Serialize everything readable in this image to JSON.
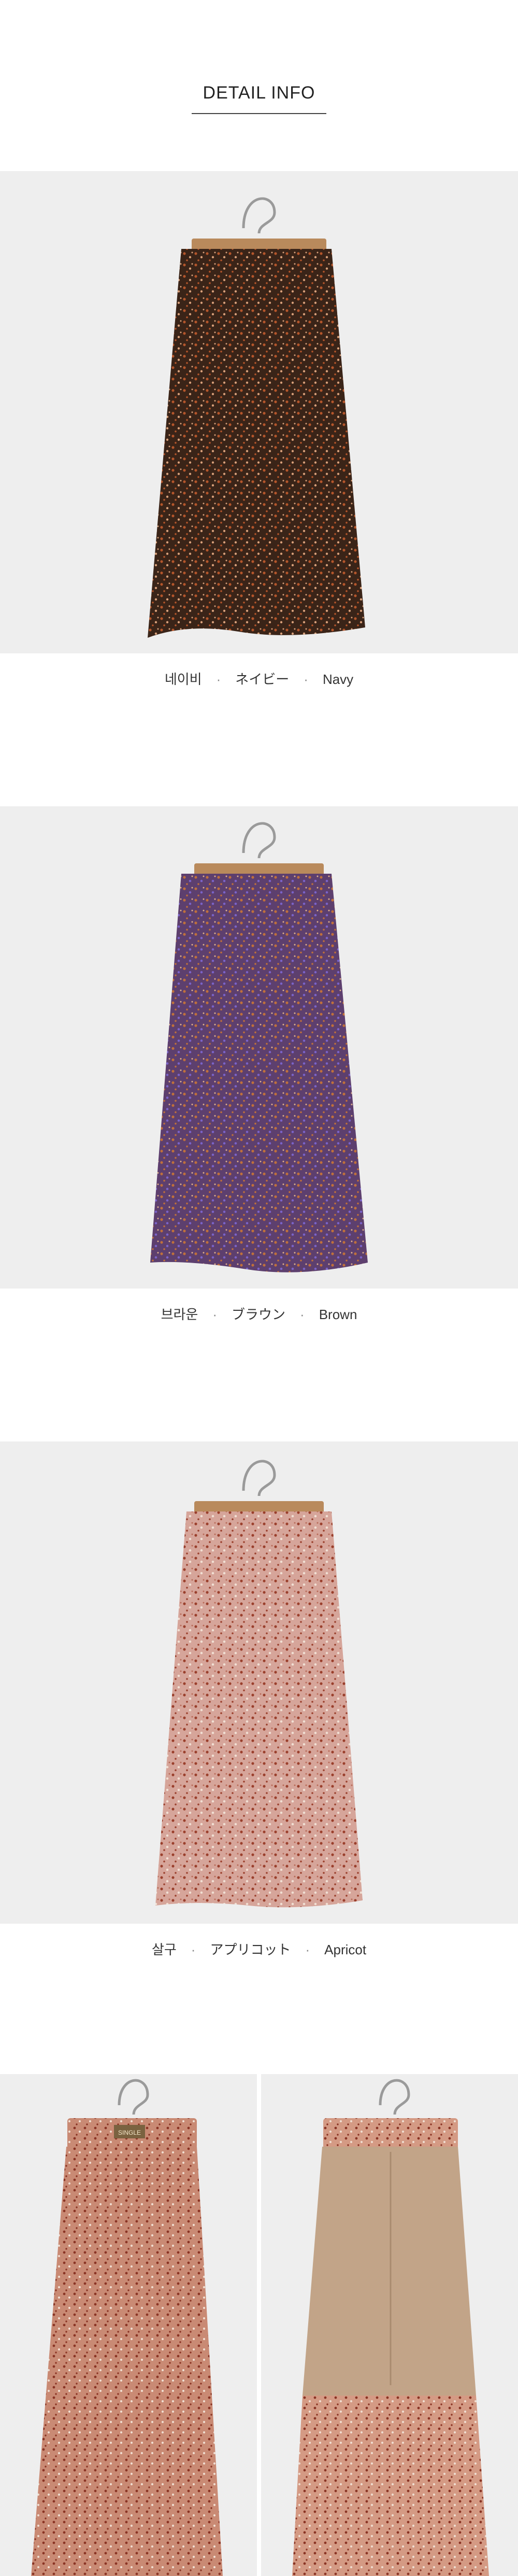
{
  "header": {
    "title": "DETAIL INFO"
  },
  "variants": [
    {
      "kr": "네이비",
      "jp": "ネイビー",
      "en": "Navy",
      "dot": "·",
      "colors": {
        "base": "#3a2418",
        "dot1": "#b5562b",
        "dot2": "#d9a07a"
      }
    },
    {
      "kr": "브라운",
      "jp": "ブラウン",
      "en": "Brown",
      "dot": "·",
      "colors": {
        "base": "#5d3f6e",
        "dot1": "#c0703b",
        "dot2": "#7a63c8"
      }
    },
    {
      "kr": "살구",
      "jp": "アプリコット",
      "en": "Apricot",
      "dot": "·",
      "colors": {
        "base": "#d6a59a",
        "dot1": "#9a3f2c",
        "dot2": "#f1dfd3"
      }
    }
  ],
  "detail_shots": [
    {
      "name": "front-view",
      "colors": {
        "base": "#c98a74",
        "dot1": "#8a3424",
        "dot2": "#f0ddd0"
      }
    },
    {
      "name": "lining-view",
      "colors": {
        "base": "#c2a488",
        "dot1": "#8a3424",
        "dot2": "#f0ddd0"
      }
    }
  ],
  "brand_tag": "SINGLE"
}
